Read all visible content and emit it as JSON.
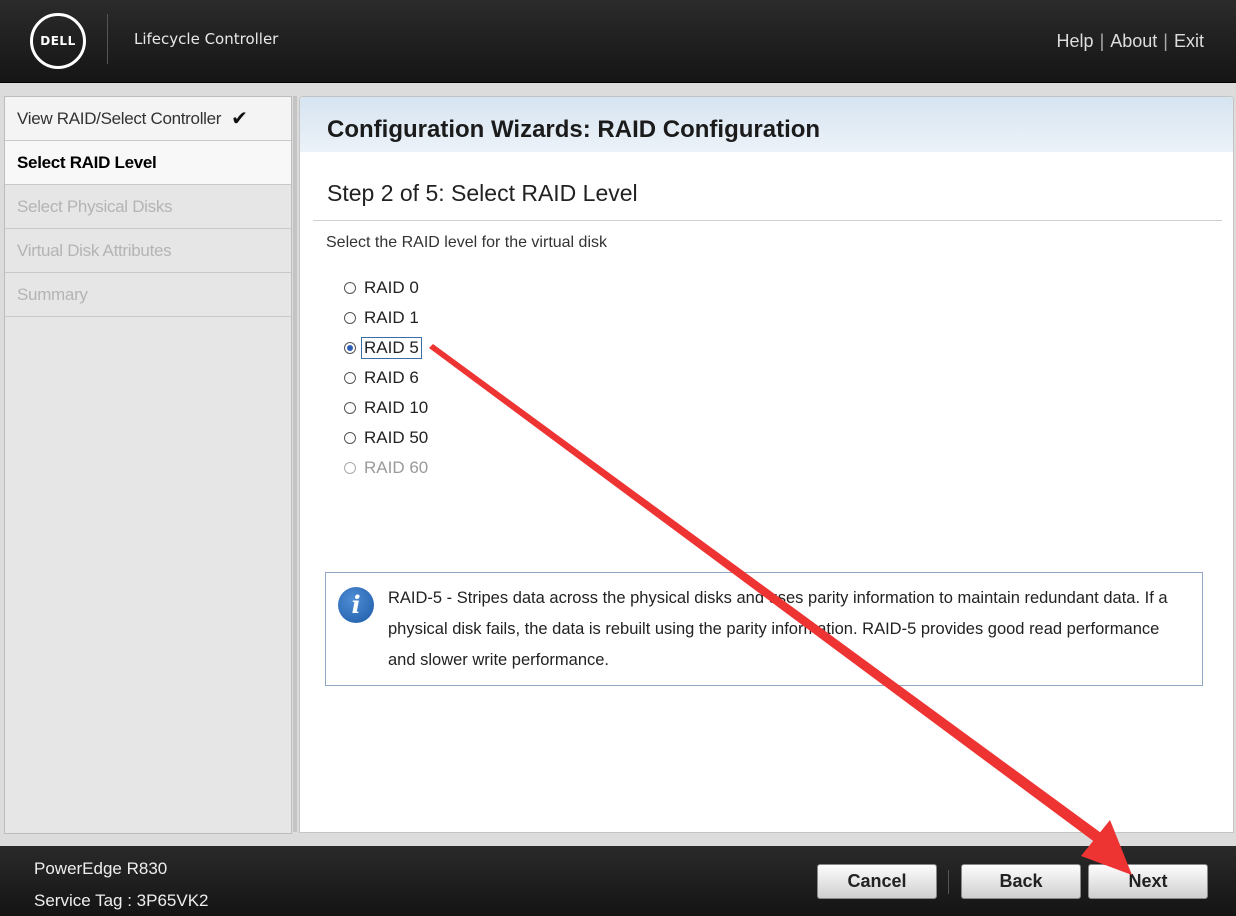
{
  "header": {
    "logo_text": "DELL",
    "app_title": "Lifecycle Controller",
    "links": [
      "Help",
      "About",
      "Exit"
    ]
  },
  "sidebar": {
    "items": [
      {
        "label": "View RAID/Select Controller",
        "state": "done"
      },
      {
        "label": "Select RAID Level",
        "state": "active"
      },
      {
        "label": "Select Physical Disks",
        "state": "pending"
      },
      {
        "label": "Virtual Disk Attributes",
        "state": "pending"
      },
      {
        "label": "Summary",
        "state": "pending"
      }
    ],
    "check_glyph": "✔"
  },
  "main": {
    "title": "Configuration Wizards: RAID Configuration",
    "step_title": "Step 2 of 5: Select RAID Level",
    "instruction": "Select the RAID level for the virtual disk",
    "raid_options": [
      {
        "label": "RAID 0",
        "selected": false,
        "disabled": false
      },
      {
        "label": "RAID 1",
        "selected": false,
        "disabled": false
      },
      {
        "label": "RAID 5",
        "selected": true,
        "disabled": false
      },
      {
        "label": "RAID 6",
        "selected": false,
        "disabled": false
      },
      {
        "label": "RAID 10",
        "selected": false,
        "disabled": false
      },
      {
        "label": "RAID 50",
        "selected": false,
        "disabled": false
      },
      {
        "label": "RAID 60",
        "selected": false,
        "disabled": true
      }
    ],
    "info": {
      "icon": "info-icon",
      "text": "RAID-5 - Stripes data across the physical disks and uses parity information to maintain redundant data. If a physical disk fails, the data is rebuilt using the parity information. RAID-5 provides good read performance and slower write performance."
    }
  },
  "footer": {
    "model": "PowerEdge R830",
    "service_tag": "Service Tag : 3P65VK2",
    "buttons": {
      "cancel": "Cancel",
      "back": "Back",
      "next": "Next"
    }
  },
  "annotation": {
    "color": "#ee3333",
    "type": "arrow"
  }
}
